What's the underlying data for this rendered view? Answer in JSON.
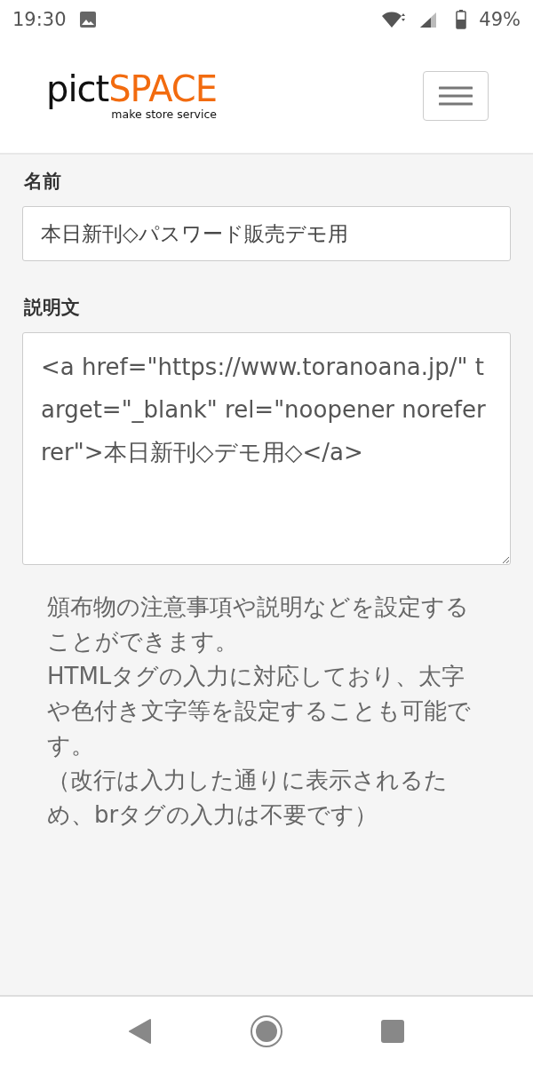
{
  "status_bar": {
    "time": "19:30",
    "battery": "49%"
  },
  "header": {
    "logo_dark": "pict",
    "logo_accent": "SPACE",
    "logo_tagline": "make store service"
  },
  "form": {
    "name_label": "名前",
    "name_value": "本日新刊◇パスワード販売デモ用",
    "description_label": "説明文",
    "description_value": "<a href=\"https://www.toranoana.jp/\" target=\"_blank\" rel=\"noopener noreferrer\">本日新刊◇デモ用◇</a>",
    "help": [
      "頒布物の注意事項や説明などを設定することができます。",
      "HTMLタグの入力に対応しており、太字や色付き文字等を設定することも可能です。",
      "（改行は入力した通りに表示されるため、brタグの入力は不要です）"
    ]
  }
}
